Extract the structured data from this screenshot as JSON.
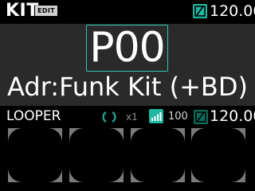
{
  "header": {
    "mode": "KIT",
    "edit_badge": "EDIT",
    "tempo_icon": "tempo-metronome-icon",
    "tempo": "120.00"
  },
  "pattern": {
    "number": "P00",
    "kit_name": "Adr:Funk Kit (+BD)"
  },
  "looper": {
    "label": "LOOPER",
    "loop_icon": "loop-icon",
    "multiplier": "x1",
    "level_icon": "level-bars-icon",
    "level": "100",
    "tempo_icon": "tempo-metronome-icon",
    "tempo": "120.00",
    "pads": [
      "pad-1",
      "pad-2",
      "pad-3",
      "pad-4"
    ]
  },
  "colors": {
    "accent": "#31c6af",
    "accent_dark": "#0a6e5c",
    "panel_bg": "#2a2a2a",
    "pad_gray": "#7a7a7a"
  }
}
